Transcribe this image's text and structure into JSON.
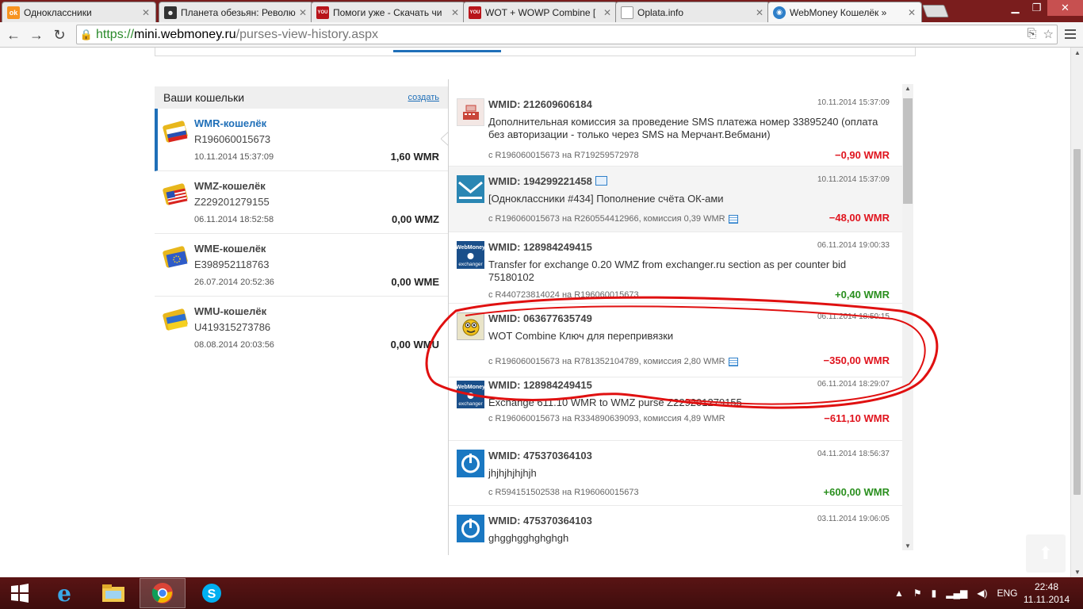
{
  "browser": {
    "tabs": [
      {
        "title": "Одноклассники",
        "icon": "odnoklassniki-icon",
        "color": "#f7931e",
        "glyph": "ok"
      },
      {
        "title": "Планета обезьян: Револю",
        "icon": "ape-icon",
        "color": "#333333",
        "glyph": ""
      },
      {
        "title": "Помоги уже - Скачать чи",
        "icon": "youhack-icon",
        "color": "#b8151b",
        "glyph": "YOU"
      },
      {
        "title": "WOT + WOWP Combine [",
        "icon": "youhack-icon",
        "color": "#b8151b",
        "glyph": "YOU"
      },
      {
        "title": "Oplata.info",
        "icon": "page-icon",
        "color": "#ffffff",
        "glyph": ""
      },
      {
        "title": "WebMoney Кошелёк »",
        "icon": "webmoney-globe-icon",
        "color": "#2e7fc9",
        "glyph": ""
      }
    ],
    "url": {
      "scheme": "https://",
      "host": "mini.webmoney.ru",
      "path": "/purses-view-history.aspx"
    }
  },
  "purses": {
    "header": "Ваши кошельки",
    "create_label": "создать",
    "items": [
      {
        "name": "WMR-кошелёк",
        "number": "R196060015673",
        "date": "10.11.2014 15:37:09",
        "balance": "1,60 WMR",
        "flag": "russia"
      },
      {
        "name": "WMZ-кошелёк",
        "number": "Z229201279155",
        "date": "06.11.2014 18:52:58",
        "balance": "0,00 WMZ",
        "flag": "usa"
      },
      {
        "name": "WME-кошелёк",
        "number": "E398952118763",
        "date": "26.07.2014 20:52:36",
        "balance": "0,00 WME",
        "flag": "eu"
      },
      {
        "name": "WMU-кошелёк",
        "number": "U419315273786",
        "date": "08.08.2014 20:03:56",
        "balance": "0,00 WMU",
        "flag": "ukraine"
      }
    ]
  },
  "history": {
    "transactions": [
      {
        "wmid": "WMID: 212609606184",
        "date": "10.11.2014 15:37:09",
        "desc": "Дополнительная комиссия за проведение SMS платежа номер 33895240 (оплата без авторизации - только через SMS на Мерчант.Вебмани)",
        "route": "с R196060015673 на R719259572978",
        "amount": "−0,90 WMR",
        "sign": "neg",
        "icon": "cash-register-icon"
      },
      {
        "wmid": "WMID: 194299221458",
        "date": "10.11.2014 15:37:09",
        "desc": "[Одноклассники #434] Пополнение счёта ОК-ами",
        "route": "с R196060015673 на R260554412966, комиссия 0,39 WMR",
        "amount": "−48,00 WMR",
        "sign": "neg",
        "icon": "envelope-icon"
      },
      {
        "wmid": "WMID: 128984249415",
        "date": "06.11.2014 19:00:33",
        "desc": "Transfer for exchange 0.20 WMZ from exchanger.ru section as per counter bid 75180102",
        "route": "с R440723814024 на R196060015673",
        "amount": "+0,40 WMR",
        "sign": "pos",
        "icon": "webmoney-exchanger-icon"
      },
      {
        "wmid": "WMID: 063677635749",
        "date": "06.11.2014 18:50:15",
        "desc": "WOT Combine Ключ для перепривязки",
        "route": "с R196060015673 на R781352104789, комиссия 2,80 WMR",
        "amount": "−350,00 WMR",
        "sign": "neg",
        "icon": "smiley-avatar-icon"
      },
      {
        "wmid": "WMID: 128984249415",
        "date": "06.11.2014 18:29:07",
        "desc": "Exchange 611.10 WMR to WMZ purse Z229201279155",
        "route": "с R196060015673 на R334890639093, комиссия 4,89 WMR",
        "amount": "−611,10 WMR",
        "sign": "neg",
        "icon": "webmoney-exchanger-icon"
      },
      {
        "wmid": "WMID: 475370364103",
        "date": "04.11.2014 18:56:37",
        "desc": "jhjhjhjhjhjh",
        "route": "с R594151502538 на R196060015673",
        "amount": "+600,00 WMR",
        "sign": "pos",
        "icon": "power-icon"
      },
      {
        "wmid": "WMID: 475370364103",
        "date": "03.11.2014 19:06:05",
        "desc": "ghgghgghghghgh",
        "route": "",
        "amount": "",
        "sign": "neg",
        "icon": "power-icon"
      }
    ]
  },
  "taskbar": {
    "lang": "ENG",
    "time": "22:48",
    "date": "11.11.2014"
  },
  "colors": {
    "accent": "#1f6fb8",
    "negative": "#e0141e",
    "positive": "#2a8f1e",
    "annotation": "#e01010"
  }
}
